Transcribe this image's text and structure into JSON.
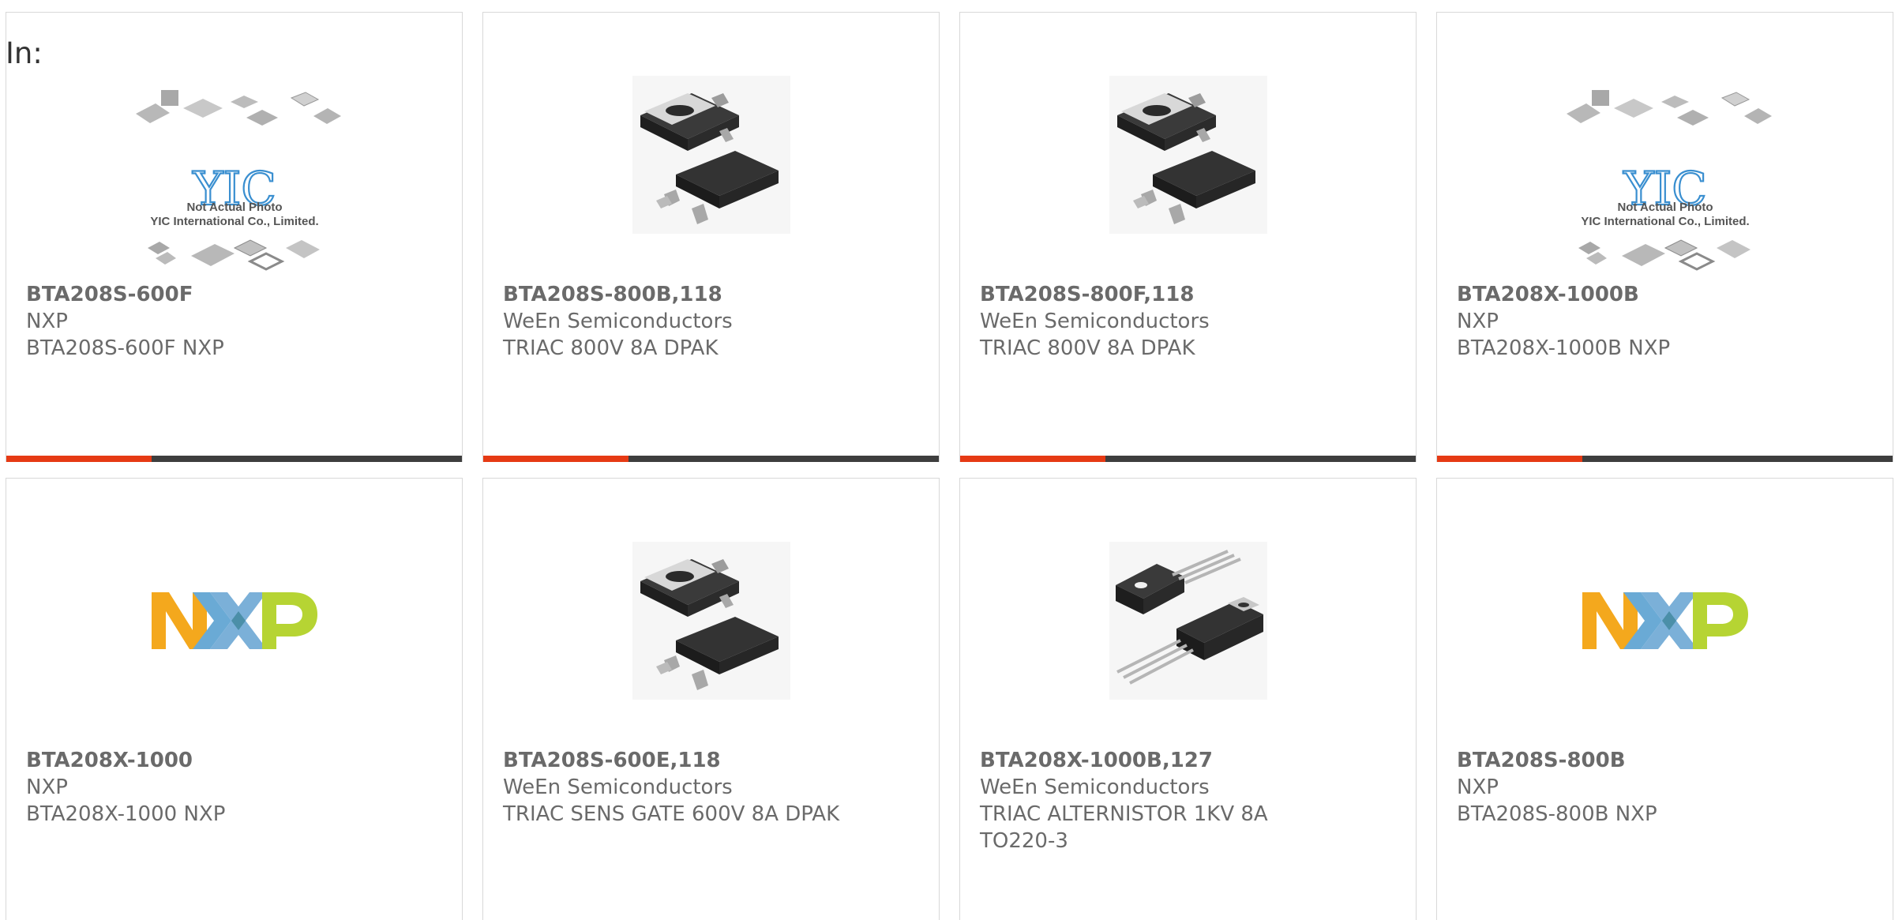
{
  "filter_label": "In:",
  "colors": {
    "accent": "#e63a14",
    "bar": "#3e3e3e",
    "border": "#d8d8d8",
    "text": "#6a6a6a"
  },
  "products": [
    {
      "part": "BTA208S-600F",
      "manufacturer": "NXP",
      "description": "BTA208S-600F NXP",
      "image": "placeholder-photo",
      "placeholder_line1": "Not Actual Photo",
      "placeholder_line2": "YIC International Co., Limited."
    },
    {
      "part": "BTA208S-800B,118",
      "manufacturer": "WeEn Semiconductors",
      "description": "TRIAC 800V 8A DPAK",
      "image": "dpak-package"
    },
    {
      "part": "BTA208S-800F,118",
      "manufacturer": "WeEn Semiconductors",
      "description": "TRIAC 800V 8A DPAK",
      "image": "dpak-package"
    },
    {
      "part": "BTA208X-1000B",
      "manufacturer": "NXP",
      "description": "BTA208X-1000B NXP",
      "image": "placeholder-photo",
      "placeholder_line1": "Not Actual Photo",
      "placeholder_line2": "YIC International Co., Limited."
    },
    {
      "part": "BTA208X-1000",
      "manufacturer": "NXP",
      "description": "BTA208X-1000 NXP",
      "image": "nxp-logo"
    },
    {
      "part": "BTA208S-600E,118",
      "manufacturer": "WeEn Semiconductors",
      "description": "TRIAC SENS GATE 600V 8A DPAK",
      "image": "dpak-package"
    },
    {
      "part": "BTA208X-1000B,127",
      "manufacturer": "WeEn Semiconductors",
      "description": "TRIAC ALTERNISTOR 1KV 8A TO220-3",
      "image": "to220-package"
    },
    {
      "part": "BTA208S-800B",
      "manufacturer": "NXP",
      "description": "BTA208S-800B NXP",
      "image": "nxp-logo"
    }
  ]
}
